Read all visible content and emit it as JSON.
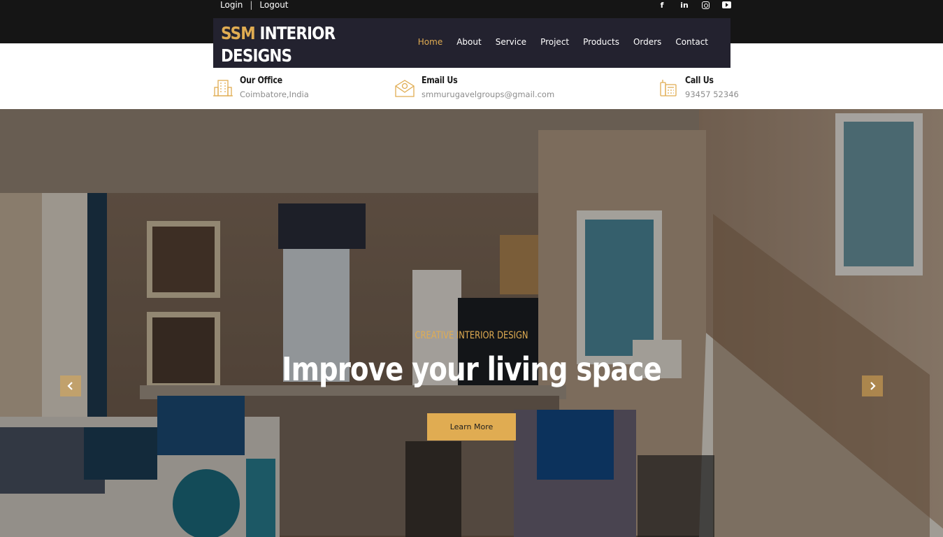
{
  "top_bar": {
    "login": "Login",
    "separator": "|",
    "logout": "Logout"
  },
  "social": {
    "facebook": "f",
    "linkedin": "in"
  },
  "brand": {
    "accent": "SSM",
    "rest": " INTERIOR DESIGNS",
    "accent_color": "#e0ac52",
    "navbar_bg": "#23222f"
  },
  "nav": {
    "items": [
      {
        "label": "Home",
        "active": true
      },
      {
        "label": "About"
      },
      {
        "label": "Service"
      },
      {
        "label": "Project"
      },
      {
        "label": "Products"
      },
      {
        "label": "Orders"
      },
      {
        "label": "Contact"
      }
    ]
  },
  "info": {
    "office": {
      "title": "Our Office",
      "value": "Coimbatore,India",
      "icon": "building-icon"
    },
    "email": {
      "title": "Email Us",
      "value": "smmurugavelgroups@gmail.com",
      "icon": "envelope-icon"
    },
    "call": {
      "title": "Call Us",
      "value": "93457 52346",
      "icon": "phone-icon"
    }
  },
  "hero": {
    "subtitle": "CREATIVE INTERIOR DESIGN",
    "title": "Improve your living space",
    "button": "Learn More",
    "prev": "‹",
    "next": "›"
  }
}
